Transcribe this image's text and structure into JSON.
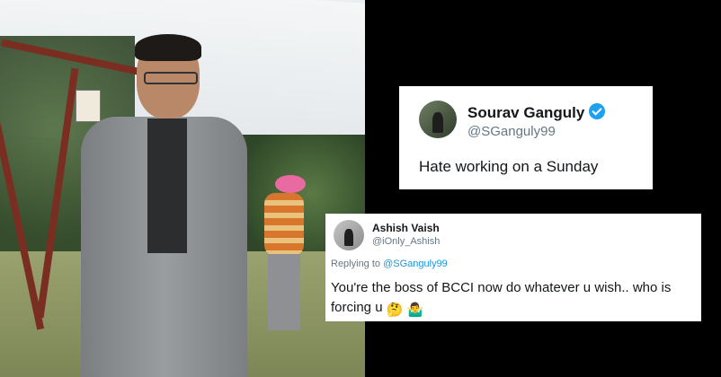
{
  "tweet1": {
    "name": "Sourav Ganguly",
    "handle": "@SGanguly99",
    "text": "Hate working on a Sunday"
  },
  "tweet2": {
    "name": "Ashish Vaish",
    "handle": "@iOnly_Ashish",
    "replying_prefix": "Replying to ",
    "replying_to": "@SGanguly99",
    "text": "You're the boss of BCCI now do whatever u wish.. who is forcing u",
    "emojis": [
      "🤔",
      "🤷‍♂️"
    ]
  },
  "colors": {
    "verified": "#1da1f2",
    "mention": "#1b95e0",
    "background": "#000000"
  }
}
